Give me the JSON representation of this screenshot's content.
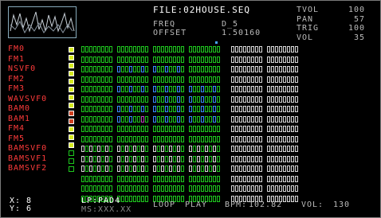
{
  "header": {
    "file_label": "FILE:",
    "file_name": "02HOUSE.SEQ"
  },
  "params": [
    {
      "key": "FREQ",
      "value": "D_5"
    },
    {
      "key": "OFFSET",
      "value": "1.50160"
    }
  ],
  "stats": [
    {
      "key": "TVOL",
      "value": "100"
    },
    {
      "key": "PAN",
      "value": "57"
    },
    {
      "key": "TRIG",
      "value": "100"
    },
    {
      "key": "VOL",
      "value": "35"
    }
  ],
  "tracks": [
    {
      "name": "FM0",
      "led": "#d6ea20"
    },
    {
      "name": "FM1",
      "led": "#d6ea20"
    },
    {
      "name": "NSVF0",
      "led": "#d6ea20"
    },
    {
      "name": "FM2",
      "led": "#d6ea20"
    },
    {
      "name": "FM3",
      "led": "#d6ea20"
    },
    {
      "name": "WAVSVF0",
      "led": "#d6ea20"
    },
    {
      "name": "BAM0",
      "led": "#d6ea20"
    },
    {
      "name": "BAM1",
      "led": "#d6ea20"
    },
    {
      "name": "FM4",
      "led": "#d04020"
    },
    {
      "name": "FM5",
      "led": "#d04020"
    },
    {
      "name": "BAMSVF0",
      "led": "#d6ea20"
    },
    {
      "name": "BAMSVF1",
      "led": "#d6ea20"
    },
    {
      "name": "BAMSVF2",
      "led": "#d6ea20"
    },
    {
      "name": "",
      "led": "outline"
    },
    {
      "name": "",
      "led": "outline"
    },
    {
      "name": "",
      "led": "outline"
    }
  ],
  "footer": {
    "x_label": "X: 8",
    "y_label": "Y: 6",
    "pattern": "LP:PAD4",
    "ms": "MS:XXX.XX"
  },
  "status": {
    "mode": "LOOP",
    "state": "PLAY",
    "bpm_label": "BPM:",
    "bpm": "102.82",
    "vol_label": "VOL:",
    "vol": "130"
  },
  "colors": {
    "track_name": "#ff3b3b",
    "step_green": "#1ec81e",
    "step_blue": "#3a8cff",
    "step_white": "#d8d8d8",
    "led_yellow": "#d6ea20",
    "led_red": "#d04020"
  }
}
